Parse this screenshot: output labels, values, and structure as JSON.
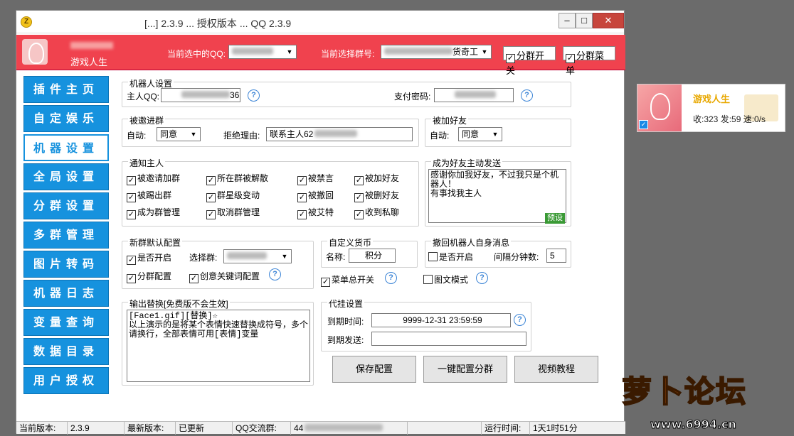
{
  "title": {
    "visible_text": "[...] 2.3.9 ... 授权版本 ... QQ 2.3.9"
  },
  "header": {
    "user_name": "游戏人生",
    "current_qq_label": "当前选中的QQ:",
    "current_group_label": "当前选择群号:",
    "group_combo_suffix": "货奇工",
    "split_switch": "分群开关",
    "split_menu": "分群菜单"
  },
  "sidebar": {
    "items": [
      "插件主页",
      "自定娱乐",
      "机器设置",
      "全局设置",
      "分群设置",
      "多群管理",
      "图片转码",
      "机器日志",
      "变量查询",
      "数据目录",
      "用户授权"
    ],
    "active_index": 2
  },
  "robot_settings": {
    "title": "机器人设置",
    "master_qq_label": "主人QQ:",
    "master_qq_suffix": "36",
    "pay_password_label": "支付密码:"
  },
  "invited_group": {
    "title": "被邀进群",
    "auto_label": "自动:",
    "auto_value": "同意",
    "reject_reason_label": "拒绝理由:",
    "reject_reason_value": "联系主人62"
  },
  "added_friend": {
    "title": "被加好友",
    "auto_label": "自动:",
    "auto_value": "同意"
  },
  "notify_master": {
    "title": "通知主人",
    "items": [
      "被邀请加群",
      "所在群被解散",
      "被禁言",
      "被加好友",
      "被踢出群",
      "群星级变动",
      "被撤回",
      "被删好友",
      "成为群管理",
      "取消群管理",
      "被艾特",
      "收到私聊"
    ]
  },
  "friend_greeting": {
    "title": "成为好友主动发送",
    "text": "感谢你加我好友，不过我只是个机器人！\n有事找我主人",
    "preset_tag": "预设"
  },
  "new_group_defaults": {
    "title": "新群默认配置",
    "enable_label": "是否开启",
    "select_group_label": "选择群:",
    "split_config": "分群配置",
    "creative_keyword": "创意关键词配置"
  },
  "currency": {
    "title": "自定义货币",
    "name_label": "名称:",
    "name_value": "积分"
  },
  "recall": {
    "title": "撤回机器人自身消息",
    "enable_label": "是否开启",
    "interval_label": "间隔分钟数:",
    "interval_value": "5"
  },
  "menu_switch": "菜单总开关",
  "image_text_mode": "图文模式",
  "output_replace": {
    "title": "输出替换[免费版不会生效]",
    "text": "[Face1.gif][替换]☆\n以上演示的是将某个表情快速替换成符号，多个请换行，全部表情可用[表情]变量"
  },
  "proxy": {
    "title": "代挂设置",
    "expire_label": "到期时间:",
    "expire_value": "9999-12-31 23:59:59",
    "expire_send_label": "到期发送:"
  },
  "buttons": {
    "save": "保存配置",
    "one_key": "一键配置分群",
    "tutorial": "视频教程"
  },
  "status": {
    "cur_ver_label": "当前版本:",
    "cur_ver": "2.3.9",
    "latest_label": "最新版本:",
    "latest": "已更新",
    "qq_group_label": "QQ交流群:",
    "qq_group_value": "44",
    "runtime_label": "运行时间:",
    "runtime": "1天1时51分"
  },
  "side_card": {
    "name": "游戏人生",
    "stats": "收:323 发:59 速:0/s"
  },
  "watermark": {
    "brand": "萝卜论坛",
    "url": "www.6994.cn"
  },
  "colors": {
    "accent_red": "#f0424e",
    "nav_blue": "#1692de"
  }
}
